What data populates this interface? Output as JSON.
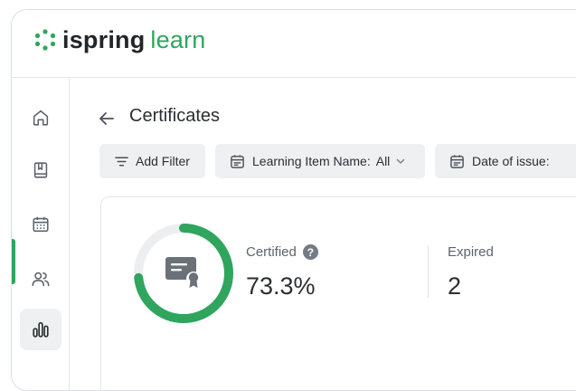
{
  "brand": {
    "name_part1": "ispring",
    "name_part2": "learn",
    "accent": "#2fa55d"
  },
  "sidebar": {
    "items": [
      {
        "name": "home",
        "icon": "home-icon",
        "active": false
      },
      {
        "name": "library",
        "icon": "book-icon",
        "active": false
      },
      {
        "name": "calendar",
        "icon": "calendar-icon",
        "active": false
      },
      {
        "name": "users",
        "icon": "users-icon",
        "active": false
      },
      {
        "name": "reports",
        "icon": "bar-chart-icon",
        "active": true
      }
    ]
  },
  "page": {
    "title": "Certificates"
  },
  "filters": {
    "add_filter": "Add Filter",
    "learning_item": "Learning Item Name:",
    "learning_item_value": "All",
    "date_of_issue": "Date of issue:"
  },
  "stats": {
    "certified_label": "Certified",
    "certified_help": "?",
    "certified_value": "73.3%",
    "certified_fraction": 0.733,
    "expired_label": "Expired",
    "expired_value": "2"
  },
  "colors": {
    "donut_fill": "#2fa55d",
    "donut_track": "#eceef0",
    "certificate_icon": "#6b7178"
  }
}
